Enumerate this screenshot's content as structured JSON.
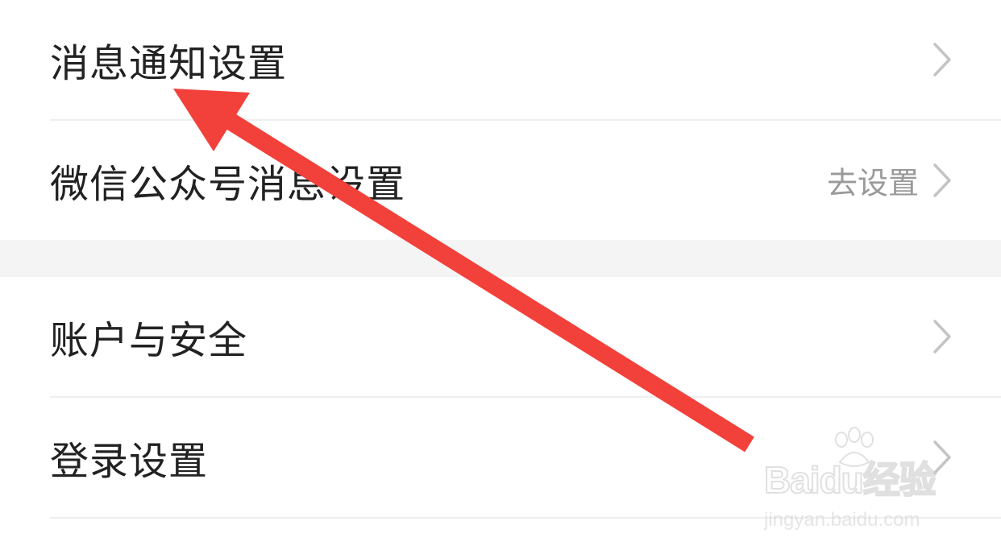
{
  "section1": {
    "items": [
      {
        "label": "消息通知设置"
      },
      {
        "label": "微信公众号消息设置",
        "value": "去设置"
      }
    ]
  },
  "section2": {
    "items": [
      {
        "label": "账户与安全"
      },
      {
        "label": "登录设置"
      }
    ]
  },
  "annotation": {
    "arrow_color": "#f2413a"
  },
  "watermark": {
    "brand": "Baidu经验",
    "url": "jingyan.baidu.com"
  },
  "colors": {
    "label": "#222222",
    "secondary": "#9a9a9a",
    "chevron": "#c4c4c4",
    "divider": "#eeeeee",
    "section_gap": "#f4f4f4"
  }
}
